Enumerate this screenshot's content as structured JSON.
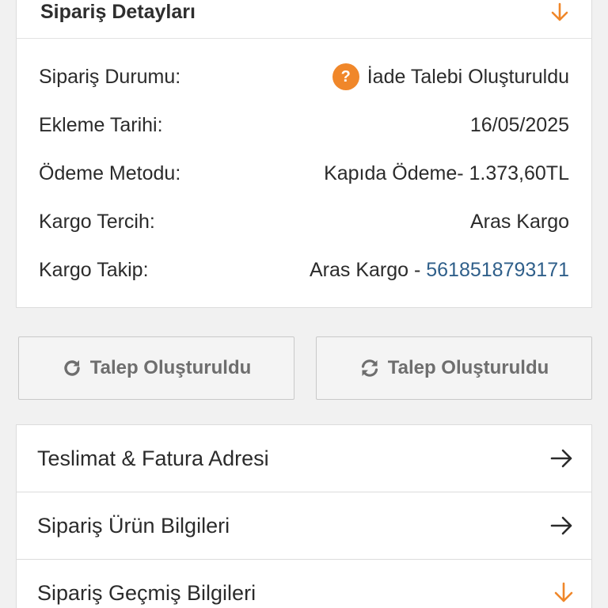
{
  "details": {
    "title": "Sipariş Detayları",
    "toggle_icon": "arrow-down-icon",
    "accent_color": "#f0872a",
    "rows": [
      {
        "label": "Sipariş Durumu:",
        "value": "İade Talebi Oluşturuldu",
        "icon": "question-icon"
      },
      {
        "label": "Ekleme Tarihi:",
        "value": "16/05/2025"
      },
      {
        "label": "Ödeme Metodu:",
        "value": "Kapıda Ödeme- 1.373,60TL"
      },
      {
        "label": "Kargo Tercih:",
        "value": "Aras Kargo"
      },
      {
        "label": "Kargo Takip:",
        "value": "Aras Kargo - ",
        "link": "5618518793171"
      }
    ]
  },
  "actions": {
    "left_button": {
      "label": "Talep Oluşturuldu",
      "icon": "redo-icon"
    },
    "right_button": {
      "label": "Talep Oluşturuldu",
      "icon": "refresh-icon"
    }
  },
  "sections": [
    {
      "label": "Teslimat & Fatura Adresi",
      "icon": "arrow-right-icon"
    },
    {
      "label": "Sipariş Ürün Bilgileri",
      "icon": "arrow-right-icon"
    },
    {
      "label": "Sipariş Geçmiş Bilgileri",
      "icon": "arrow-down-icon"
    }
  ],
  "colors": {
    "link": "#2f5f8a",
    "accent": "#f0872a"
  }
}
